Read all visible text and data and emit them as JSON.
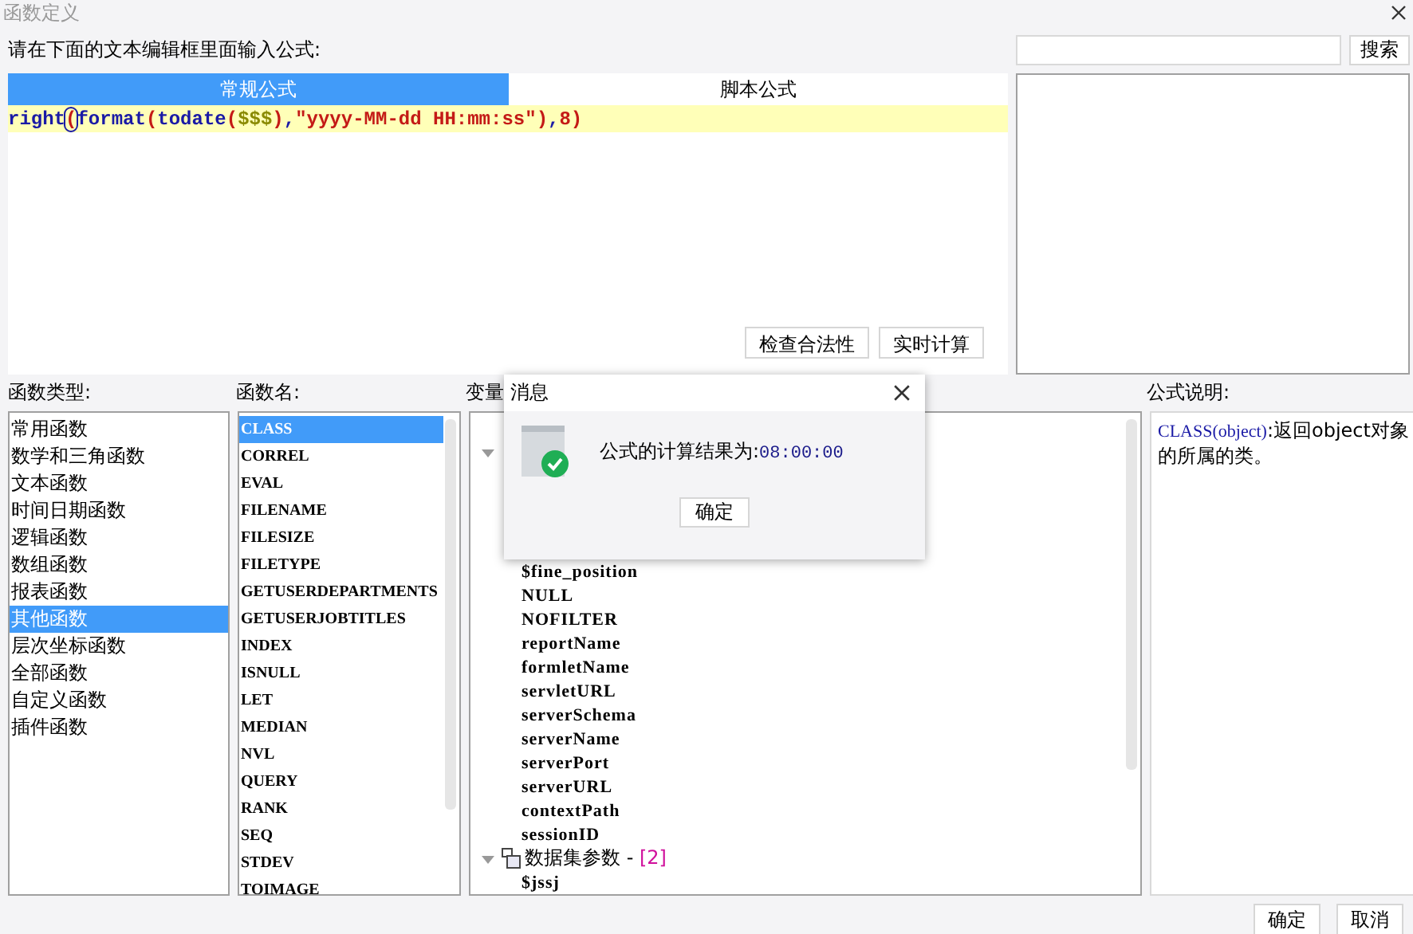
{
  "window": {
    "title": "函数定义"
  },
  "prompt": "请在下面的文本编辑框里面输入公式:",
  "tabs": [
    {
      "label": "常规公式",
      "selected": true
    },
    {
      "label": "脚本公式",
      "selected": false
    }
  ],
  "formula": [
    {
      "kind": "func",
      "text": "right"
    },
    {
      "kind": "paren",
      "text": "(",
      "cursor": true
    },
    {
      "kind": "func",
      "text": "format"
    },
    {
      "kind": "paren",
      "text": "("
    },
    {
      "kind": "func",
      "text": "todate"
    },
    {
      "kind": "paren",
      "text": "("
    },
    {
      "kind": "var",
      "text": "$$$"
    },
    {
      "kind": "paren",
      "text": ")"
    },
    {
      "kind": "plain",
      "text": ","
    },
    {
      "kind": "string",
      "text": "\"yyyy-MM-dd HH:mm:ss\""
    },
    {
      "kind": "paren",
      "text": ")"
    },
    {
      "kind": "plain",
      "text": ","
    },
    {
      "kind": "number",
      "text": "8"
    },
    {
      "kind": "paren",
      "text": ")"
    }
  ],
  "search": {
    "button": "搜索"
  },
  "editor_buttons": [
    "检查合法性",
    "实时计算"
  ],
  "function_types": {
    "label": "函数类型:",
    "items": [
      {
        "label": "常用函数",
        "selected": false
      },
      {
        "label": "数学和三角函数",
        "selected": false
      },
      {
        "label": "文本函数",
        "selected": false
      },
      {
        "label": "时间日期函数",
        "selected": false
      },
      {
        "label": "逻辑函数",
        "selected": false
      },
      {
        "label": "数组函数",
        "selected": false
      },
      {
        "label": "报表函数",
        "selected": false
      },
      {
        "label": "其他函数",
        "selected": true
      },
      {
        "label": "层次坐标函数",
        "selected": false
      },
      {
        "label": "全部函数",
        "selected": false
      },
      {
        "label": "自定义函数",
        "selected": false
      },
      {
        "label": "插件函数",
        "selected": false
      }
    ]
  },
  "function_names": {
    "label": "函数名:",
    "items": [
      {
        "label": "CLASS",
        "selected": true
      },
      {
        "label": "CORREL",
        "selected": false
      },
      {
        "label": "EVAL",
        "selected": false
      },
      {
        "label": "FILENAME",
        "selected": false
      },
      {
        "label": "FILESIZE",
        "selected": false
      },
      {
        "label": "FILETYPE",
        "selected": false
      },
      {
        "label": "GETUSERDEPARTMENTS",
        "selected": false
      },
      {
        "label": "GETUSERJOBTITLES",
        "selected": false
      },
      {
        "label": "INDEX",
        "selected": false
      },
      {
        "label": "ISNULL",
        "selected": false
      },
      {
        "label": "LET",
        "selected": false
      },
      {
        "label": "MEDIAN",
        "selected": false
      },
      {
        "label": "NVL",
        "selected": false
      },
      {
        "label": "QUERY",
        "selected": false
      },
      {
        "label": "RANK",
        "selected": false
      },
      {
        "label": "SEQ",
        "selected": false
      },
      {
        "label": "STDEV",
        "selected": false
      },
      {
        "label": "TOIMAGE",
        "selected": false
      }
    ]
  },
  "variables": {
    "label": "变量",
    "groups": [
      {
        "expanded": true,
        "children": [
          "$fine_position",
          "NULL",
          "NOFILTER",
          "reportName",
          "formletName",
          "servletURL",
          "serverSchema",
          "serverName",
          "serverPort",
          "serverURL",
          "contextPath",
          "sessionID"
        ]
      },
      {
        "label": "数据集参数 - ",
        "count": "[2]",
        "expanded": true,
        "children": [
          "$jssj"
        ]
      }
    ]
  },
  "description": {
    "label": "公式说明:",
    "signature": "CLASS(object)",
    "text": ":返回object对象的所属的类。"
  },
  "dialog": {
    "title": "消息",
    "message": "公式的计算结果为:",
    "result": "08:00:00",
    "ok": "确定"
  },
  "footer_buttons": [
    "确定",
    "取消"
  ]
}
